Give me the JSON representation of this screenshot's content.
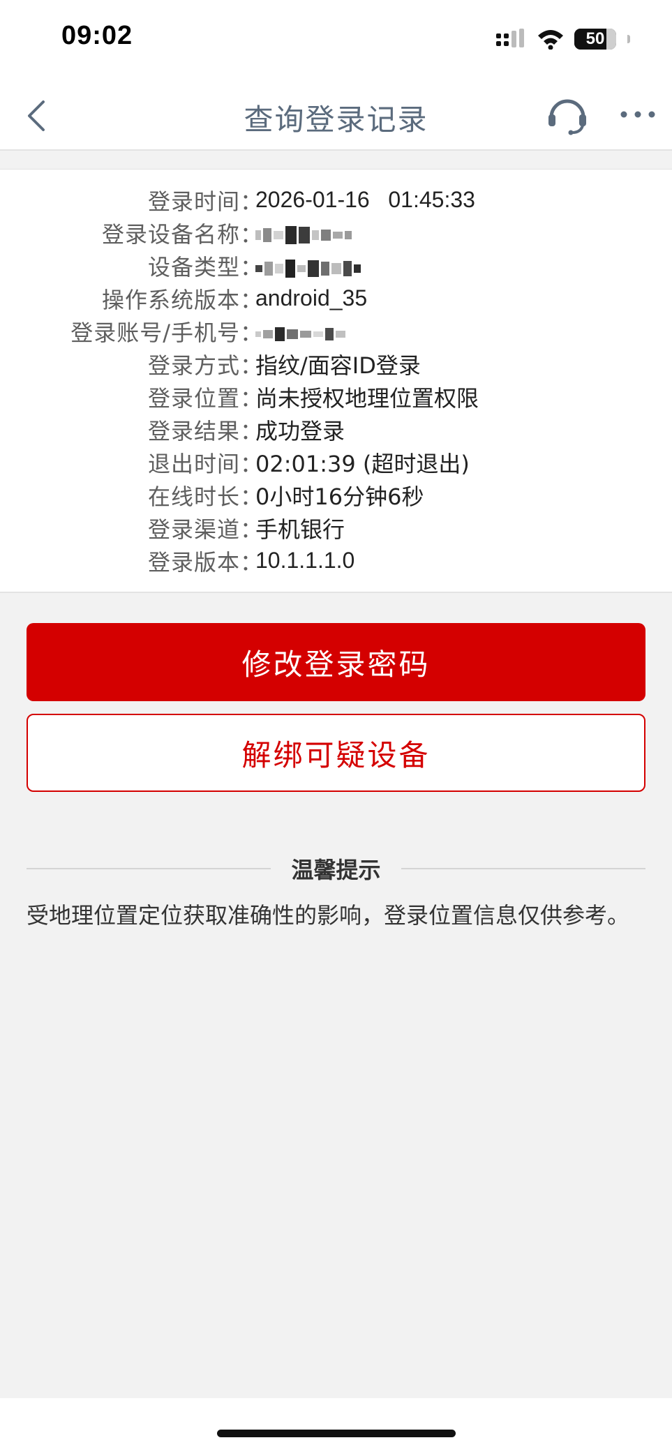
{
  "status_bar": {
    "time": "09:02",
    "battery": "50",
    "battery_level": 0.5,
    "icons": [
      "signal-icon",
      "wifi-icon",
      "battery-icon"
    ]
  },
  "nav": {
    "title": "查询登录记录",
    "back_icon": "chevron-left-icon",
    "support_icon": "headset-icon",
    "more_icon": "more-dots-icon"
  },
  "login_record": {
    "colon": "：",
    "fields": [
      {
        "label": "登录时间",
        "value": "2026-01-16   01:45:33"
      },
      {
        "label": "登录设备名称",
        "value": ""
      },
      {
        "label": "设备类型",
        "value": ""
      },
      {
        "label": "操作系统版本",
        "value": "android_35"
      },
      {
        "label": "登录账号/手机号",
        "value": ""
      },
      {
        "label": "登录方式",
        "value": "指纹/面容ID登录"
      },
      {
        "label": "登录位置",
        "value": "尚未授权地理位置权限"
      },
      {
        "label": "登录结果",
        "value": "成功登录"
      },
      {
        "label": "退出时间",
        "value": "02:01:39 (超时退出)"
      },
      {
        "label": "在线时长",
        "value": "0小时16分钟6秒"
      },
      {
        "label": "登录渠道",
        "value": "手机银行"
      },
      {
        "label": "登录版本",
        "value": "10.1.1.1.0"
      }
    ]
  },
  "actions": {
    "change_password": "修改登录密码",
    "unbind_device": "解绑可疑设备"
  },
  "tips": {
    "title": "温馨提示",
    "text": "受地理位置定位获取准确性的影响，登录位置信息仅供参考。"
  },
  "colors": {
    "brand_red": "#d40000",
    "title_gray_blue": "#5b6b7d",
    "page_background": "#f2f2f2"
  }
}
